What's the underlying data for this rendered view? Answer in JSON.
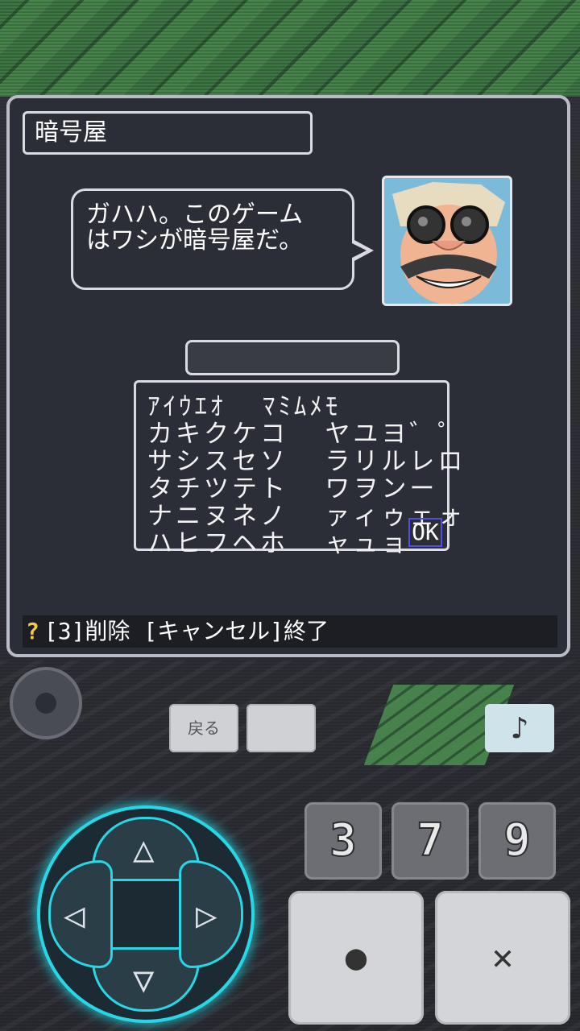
{
  "dialog": {
    "speaker": "暗号屋",
    "message_line1": "ガハハ。このゲーム",
    "message_line2": "はワシが暗号屋だ。"
  },
  "kana_grid": {
    "rows": [
      "ｱｲｳｴｵ  ﾏﾐﾑﾒﾓ",
      "カキクケコ  ヤユヨ゛゜",
      "サシスセソ  ラリルレロ",
      "タチツテト  ワヲンー",
      "ナニヌネノ  ァィゥェォ",
      "ハヒフヘホ  ャュョ"
    ],
    "ok_label": "OK"
  },
  "help": {
    "icon": "question-icon",
    "text": "[3]削除 [キャンセル]終了"
  },
  "controls": {
    "back_label": "戻る",
    "music_icon": "♪",
    "num_buttons": [
      "3",
      "7",
      "9"
    ],
    "confirm_symbol": "●",
    "cancel_symbol": "✕",
    "accent_color": "#27d7e6"
  }
}
